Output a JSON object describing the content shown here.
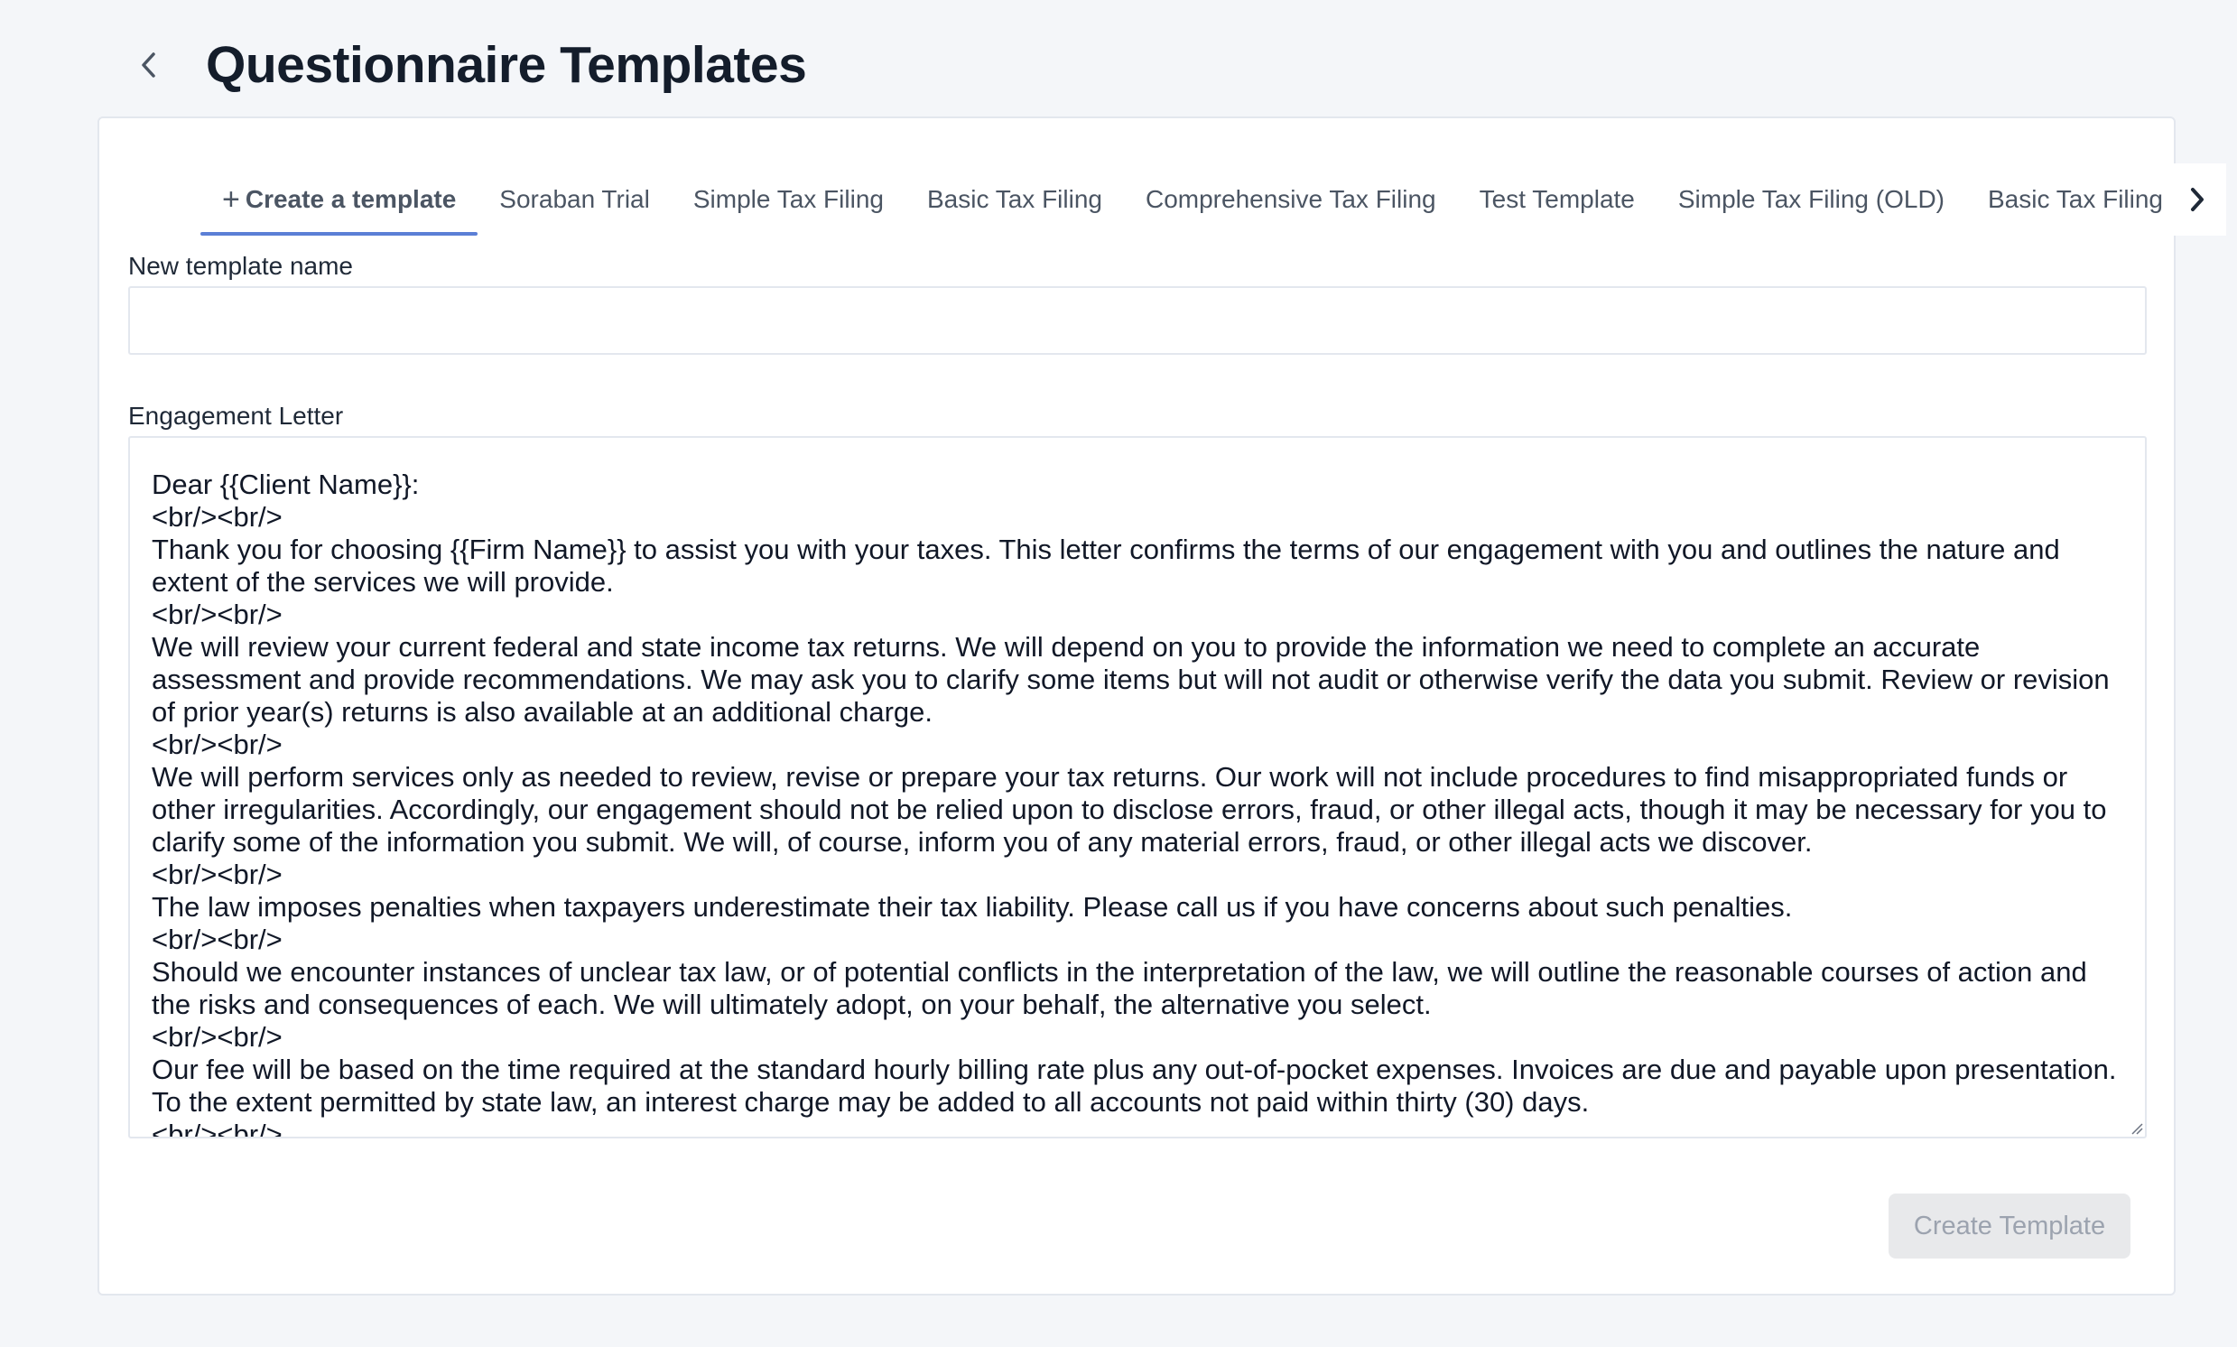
{
  "header": {
    "title": "Questionnaire Templates"
  },
  "tabs": [
    {
      "label": "Create a template",
      "active": true
    },
    {
      "label": "Soraban Trial"
    },
    {
      "label": "Simple Tax Filing"
    },
    {
      "label": "Basic Tax Filing"
    },
    {
      "label": "Comprehensive Tax Filing"
    },
    {
      "label": "Test Template"
    },
    {
      "label": "Simple Tax Filing (OLD)"
    },
    {
      "label": "Basic Tax Filing"
    }
  ],
  "form": {
    "name_label": "New template name",
    "name_value": "",
    "letter_label": "Engagement Letter",
    "letter_lines": [
      "Dear {{Client Name}}:",
      "<br/><br/>",
      "Thank you for choosing {{Firm Name}} to assist you with your taxes. This letter confirms the terms of our engagement with you and outlines the nature and extent of the services we will provide.",
      "<br/><br/>",
      "We will review your current federal and state income tax returns. We will depend on you to provide the information we need to complete an accurate assessment and provide recommendations. We may ask you to clarify some items but will not audit or otherwise verify the data you submit. Review or revision of prior year(s) returns is also available at an additional charge.",
      "<br/><br/>",
      "We will perform services only as needed to review, revise or prepare your tax returns. Our work will not include procedures to find misappropriated funds or other irregularities. Accordingly, our engagement should not be relied upon to disclose errors, fraud, or other illegal acts, though it may be necessary for you to clarify some of the information you submit. We will, of course, inform you of any material errors, fraud, or other illegal acts we discover.",
      "<br/><br/>",
      "The law imposes penalties when taxpayers underestimate their tax liability. Please call us if you have concerns about such penalties.",
      "<br/><br/>",
      "Should we encounter instances of unclear tax law, or of potential conflicts in the interpretation of the law, we will outline the reasonable courses of action and the risks and consequences of each. We will ultimately adopt, on your behalf, the alternative you select.",
      "<br/><br/>",
      "Our fee will be based on the time required at the standard hourly billing rate plus any out-of-pocket expenses. Invoices are due and payable upon presentation. To the extent permitted by state law, an interest charge may be added to all accounts not paid within thirty (30) days.",
      "<br/><br/>"
    ],
    "submit_label": "Create Template"
  }
}
